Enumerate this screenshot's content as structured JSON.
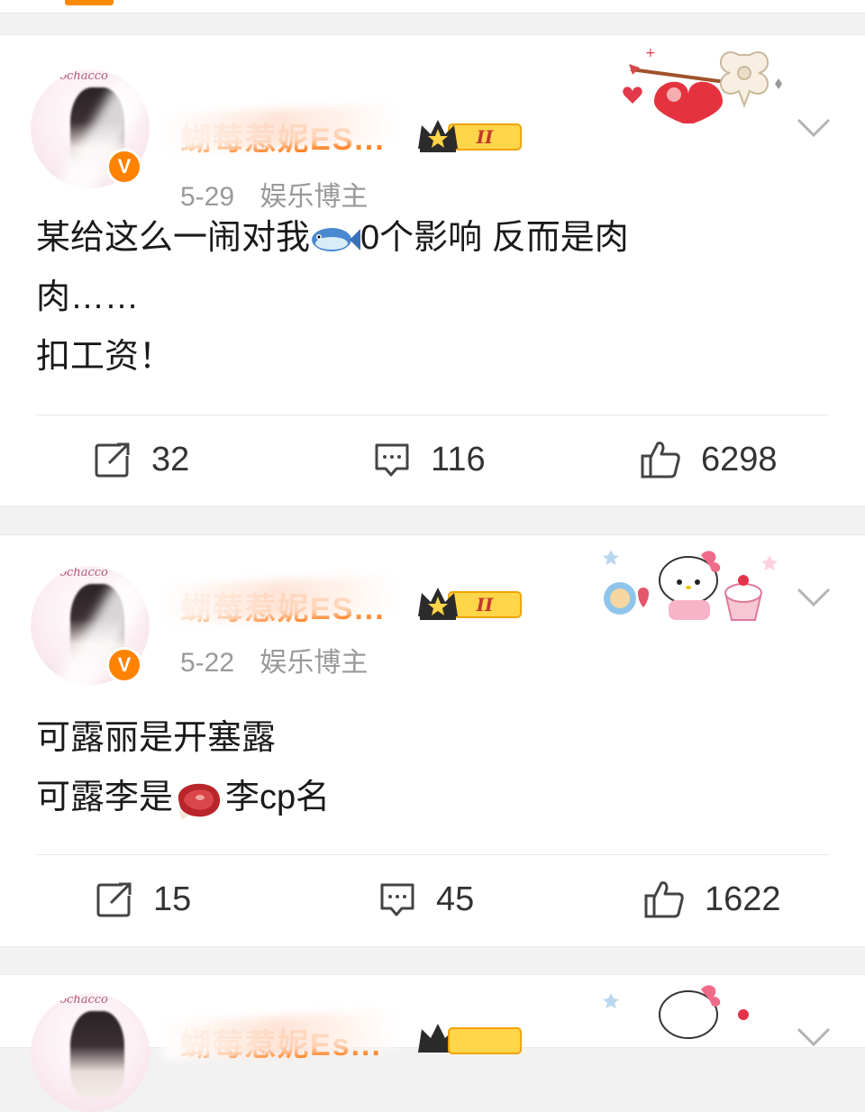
{
  "posts": [
    {
      "username": "蝴莓惹妮ES...",
      "level_badge": "II",
      "date": "5-29",
      "role": "娱乐博主",
      "avatar_caption": "Pochacco",
      "verified_mark": "V",
      "text_lines": [
        "某给这么一闹对我",
        "0个影响 反而是肉",
        "肉……",
        "扣工资！"
      ],
      "emoji_inline": "fish",
      "repost_count": "32",
      "comment_count": "116",
      "like_count": "6298"
    },
    {
      "username": "蝴莓惹妮ES...",
      "level_badge": "II",
      "date": "5-22",
      "role": "娱乐博主",
      "avatar_caption": "Pochacco",
      "verified_mark": "V",
      "text_lines": [
        "可露丽是开塞露",
        "可露李是",
        "李cp名"
      ],
      "emoji_inline": "steak",
      "repost_count": "15",
      "comment_count": "45",
      "like_count": "1622"
    },
    {
      "username": "蝴莓惹妮Es...",
      "avatar_caption": "Pochacco"
    }
  ],
  "icons": {
    "repost": "repost-icon",
    "comment": "comment-icon",
    "like": "thumbs-up-icon",
    "menu": "chevron-down-icon"
  },
  "colors": {
    "username": "#ff7a14",
    "meta": "#999999",
    "verified": "#ff8200",
    "background": "#f2f2f2"
  }
}
